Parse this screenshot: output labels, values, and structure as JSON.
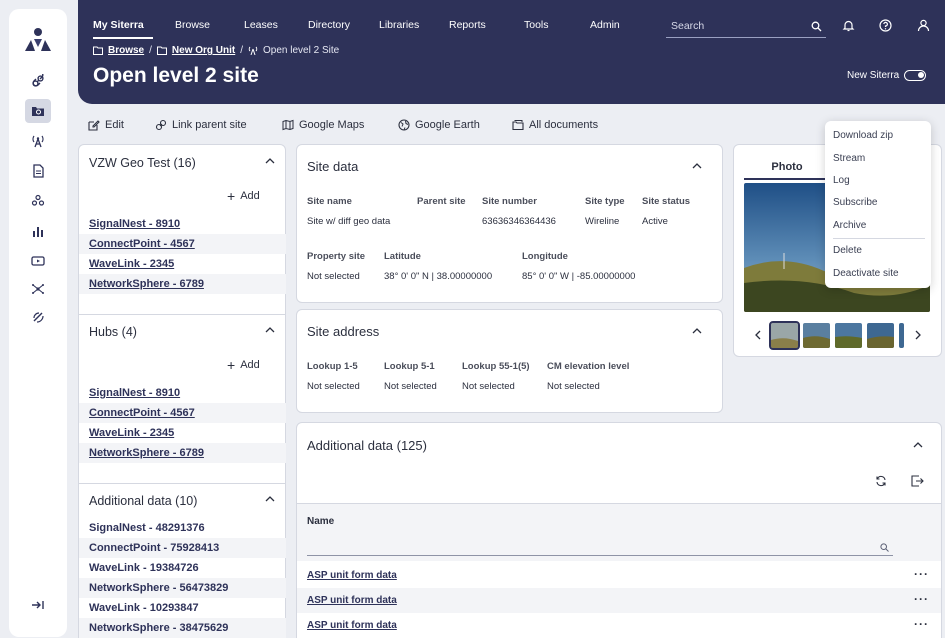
{
  "nav": {
    "items": [
      "My Siterra",
      "Browse",
      "Leases",
      "Directory",
      "Libraries",
      "Reports",
      "Tools",
      "Admin"
    ],
    "search_placeholder": "Search"
  },
  "breadcrumb": {
    "browse": "Browse",
    "org_unit": "New Org Unit",
    "current": "Open level 2 Site"
  },
  "page_title": "Open level 2 site",
  "new_siterra_label": "New Siterra",
  "toolbar": {
    "edit": "Edit",
    "link_parent": "Link parent site",
    "google_maps": "Google Maps",
    "google_earth": "Google Earth",
    "all_documents": "All documents"
  },
  "left_panels": {
    "geo": {
      "title": "VZW Geo Test (16)",
      "add": "Add",
      "items": [
        "SignalNest - 8910",
        "ConnectPoint - 4567",
        "WaveLink - 2345",
        "NetworkSphere - 6789"
      ]
    },
    "hubs": {
      "title": "Hubs (4)",
      "add": "Add",
      "items": [
        "SignalNest - 8910",
        "ConnectPoint - 4567",
        "WaveLink - 2345",
        "NetworkSphere - 6789"
      ]
    },
    "additional": {
      "title": "Additional data (10)",
      "items": [
        "SignalNest - 48291376",
        "ConnectPoint - 75928413",
        "WaveLink - 19384726",
        "NetworkSphere - 56473829",
        "WaveLink - 10293847",
        "NetworkSphere - 38475629"
      ]
    }
  },
  "site_data": {
    "title": "Site data",
    "row1_labels": [
      "Site name",
      "Parent site",
      "Site number",
      "Site type",
      "Site status"
    ],
    "row1_values": [
      "Site w/ diff geo data",
      "",
      "63636346364436",
      "Wireline",
      "Active"
    ],
    "row2_labels": [
      "Property site",
      "Latitude",
      "Longitude"
    ],
    "row2_values": [
      "Not selected",
      "38° 0' 0\" N | 38.00000000",
      "85° 0' 0\" W | -85.00000000"
    ]
  },
  "site_address": {
    "title": "Site address",
    "labels": [
      "Lookup 1-5",
      "Lookup 5-1",
      "Lookup 55-1(5)",
      "CM elevation level"
    ],
    "values": [
      "Not selected",
      "Not selected",
      "Not selected",
      "Not selected"
    ]
  },
  "additional_data": {
    "title": "Additional data (125)",
    "column": "Name",
    "rows": [
      "ASP unit form data",
      "ASP unit form data",
      "ASP unit form data"
    ]
  },
  "photo": {
    "tab": "Photo"
  },
  "menu": {
    "items": [
      "Download zip",
      "Stream",
      "Log",
      "Subscribe",
      "Archive"
    ],
    "danger_items": [
      "Delete",
      "Deactivate site"
    ]
  },
  "colors": {
    "header": "#2e3259",
    "accent": "#2e3259",
    "panel_bg": "#eceef3"
  }
}
